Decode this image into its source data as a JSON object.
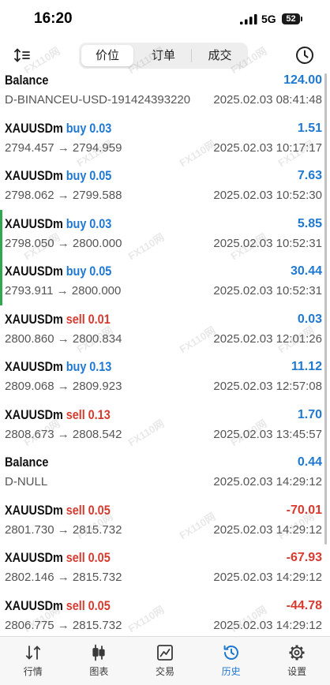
{
  "status_bar": {
    "time": "16:20",
    "signal_icon": "signal-icon",
    "network": "5G",
    "battery": "52",
    "battery_icon": "battery-icon"
  },
  "header": {
    "sort_icon": "sort-icon",
    "tabs": [
      {
        "label": "价位",
        "selected": true
      },
      {
        "label": "订单",
        "selected": false
      },
      {
        "label": "成交",
        "selected": false
      }
    ],
    "period_icon": "clock-icon"
  },
  "colors": {
    "text": "#111111",
    "secondary_text": "#555555",
    "buy": "#1f78d1",
    "sell": "#d93a2f",
    "profit": "#1f78d1",
    "loss": "#d93a2f",
    "highlight_marker": "#2fa84f",
    "nav_active": "#1f78d1",
    "nav_inactive": "#3a3a3a"
  },
  "history": [
    {
      "symbol": "Balance",
      "profit": "124.00",
      "detail": "D-BINANCEU-USD-191424393220",
      "time": "2025.02.03 08:41:48"
    },
    {
      "symbol": "XAUUSDm",
      "side": "buy",
      "volume": "0.03",
      "profit": "1.51",
      "detail": "2794.457 → 2794.959",
      "time": "2025.02.03 10:17:17"
    },
    {
      "symbol": "XAUUSDm",
      "side": "buy",
      "volume": "0.05",
      "profit": "7.63",
      "detail": "2798.062 → 2799.588",
      "time": "2025.02.03 10:52:30"
    },
    {
      "symbol": "XAUUSDm",
      "side": "buy",
      "volume": "0.03",
      "profit": "5.85",
      "detail": "2798.050 → 2800.000",
      "time": "2025.02.03 10:52:31",
      "highlighted": true
    },
    {
      "symbol": "XAUUSDm",
      "side": "buy",
      "volume": "0.05",
      "profit": "30.44",
      "detail": "2793.911 → 2800.000",
      "time": "2025.02.03 10:52:31",
      "highlighted": true
    },
    {
      "symbol": "XAUUSDm",
      "side": "sell",
      "volume": "0.01",
      "profit": "0.03",
      "detail": "2800.860 → 2800.834",
      "time": "2025.02.03 12:01:26"
    },
    {
      "symbol": "XAUUSDm",
      "side": "buy",
      "volume": "0.13",
      "profit": "11.12",
      "detail": "2809.068 → 2809.923",
      "time": "2025.02.03 12:57:08"
    },
    {
      "symbol": "XAUUSDm",
      "side": "sell",
      "volume": "0.13",
      "profit": "1.70",
      "detail": "2808.673 → 2808.542",
      "time": "2025.02.03 13:45:57"
    },
    {
      "symbol": "Balance",
      "profit": "0.44",
      "detail": "D-NULL",
      "time": "2025.02.03 14:29:12"
    },
    {
      "symbol": "XAUUSDm",
      "side": "sell",
      "volume": "0.05",
      "profit": "-70.01",
      "detail": "2801.730 → 2815.732",
      "time": "2025.02.03 14:29:12"
    },
    {
      "symbol": "XAUUSDm",
      "side": "sell",
      "volume": "0.05",
      "profit": "-67.93",
      "detail": "2802.146 → 2815.732",
      "time": "2025.02.03 14:29:12"
    },
    {
      "symbol": "XAUUSDm",
      "side": "sell",
      "volume": "0.05",
      "profit": "-44.78",
      "detail": "2806.775 → 2815.732",
      "time": "2025.02.03 14:29:12"
    }
  ],
  "bottom_nav": [
    {
      "label": "行情",
      "icon": "quotes-icon",
      "active": false
    },
    {
      "label": "图表",
      "icon": "candlestick-chart-icon",
      "active": false
    },
    {
      "label": "交易",
      "icon": "trade-chart-icon",
      "active": false
    },
    {
      "label": "历史",
      "icon": "history-icon",
      "active": true
    },
    {
      "label": "设置",
      "icon": "gear-icon",
      "active": false
    }
  ],
  "watermark": {
    "text": "FX110网"
  }
}
